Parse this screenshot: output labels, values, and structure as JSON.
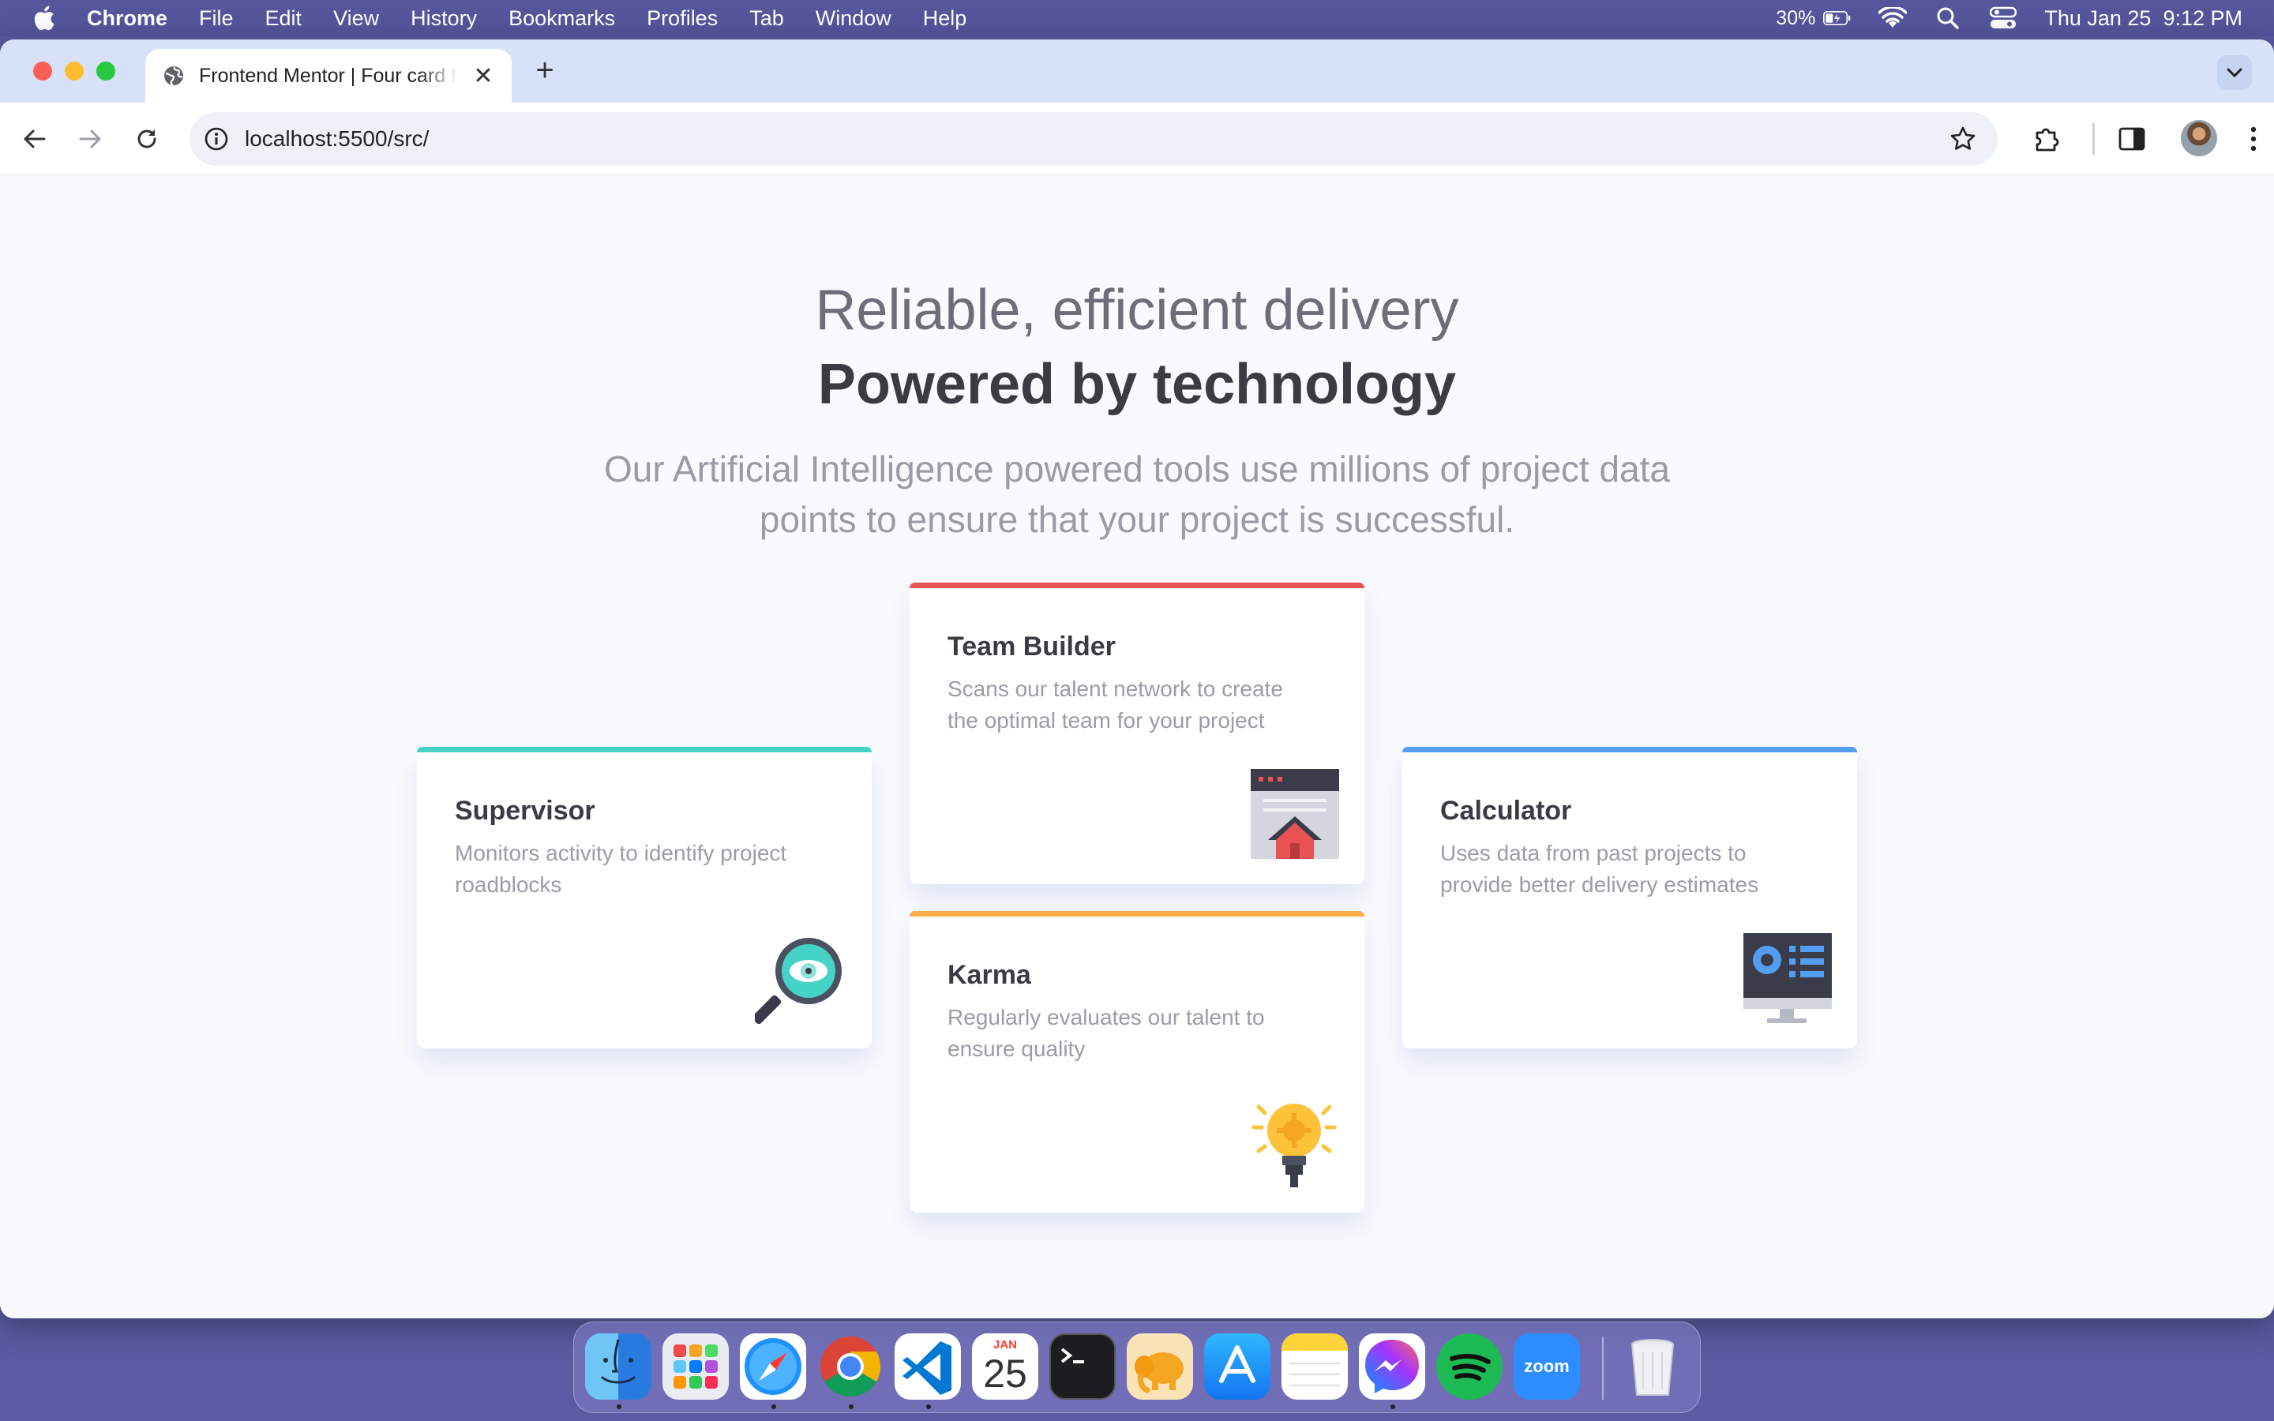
{
  "menubar": {
    "app_name": "Chrome",
    "items": [
      "File",
      "Edit",
      "View",
      "History",
      "Bookmarks",
      "Profiles",
      "Tab",
      "Window",
      "Help"
    ],
    "battery": "30%",
    "datetime": "Thu Jan 25  9:12 PM"
  },
  "browser": {
    "tab_title": "Frontend Mentor | Four card feature section",
    "url": "localhost:5500/src/"
  },
  "page": {
    "heading_light": "Reliable, efficient delivery",
    "heading_bold": "Powered by technology",
    "description": "Our Artificial Intelligence powered tools use millions of project data points to ensure that your project is successful.",
    "cards": [
      {
        "title": "Supervisor",
        "description": "Monitors activity to identify project roadblocks",
        "accent": "#45d3c7",
        "icon": "magnifier-icon"
      },
      {
        "title": "Team Builder",
        "description": "Scans our talent network to create the optimal team for your project",
        "accent": "#ea5353",
        "icon": "team-builder-icon"
      },
      {
        "title": "Karma",
        "description": "Regularly evaluates our talent to ensure quality",
        "accent": "#fcae4a",
        "icon": "lightbulb-icon"
      },
      {
        "title": "Calculator",
        "description": "Uses data from past projects to provide better delivery estimates",
        "accent": "#549ef2",
        "icon": "monitor-icon"
      }
    ]
  },
  "dock": {
    "calendar_month": "JAN",
    "calendar_day": "25",
    "zoom_label": "zoom",
    "apps": [
      "finder",
      "launchpad",
      "safari",
      "chrome",
      "vscode",
      "calendar",
      "terminal",
      "tableplus",
      "app-store",
      "notes",
      "messenger",
      "spotify",
      "zoom",
      "trash"
    ]
  }
}
